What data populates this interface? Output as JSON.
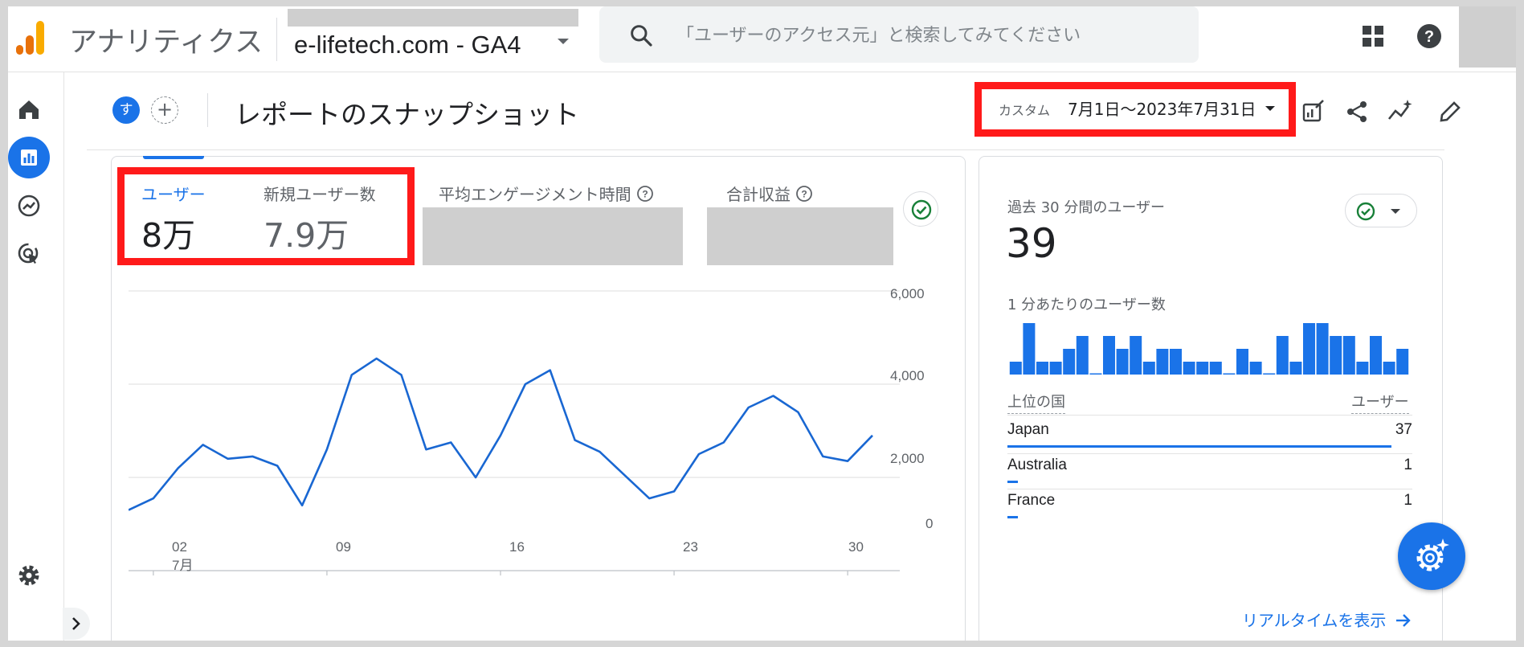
{
  "app": {
    "title": "アナリティクス",
    "property": "e-lifetech.com - GA4"
  },
  "search": {
    "placeholder": "「ユーザーのアクセス元」と検索してみてください"
  },
  "header": {
    "avatar_letter": "す",
    "add_label": "+",
    "page_title": "レポートのスナップショット",
    "date_label": "カスタム",
    "date_value": "7月1日〜2023年7月31日"
  },
  "metrics": [
    {
      "label": "ユーザー",
      "value": "8万"
    },
    {
      "label": "新規ユーザー数",
      "value": "7.9万"
    },
    {
      "label": "平均エンゲージメント時間",
      "value": ""
    },
    {
      "label": "合計収益",
      "value": ""
    }
  ],
  "chart_data": {
    "type": "line",
    "x": [
      "7/1",
      "7/2",
      "7/3",
      "7/4",
      "7/5",
      "7/6",
      "7/7",
      "7/8",
      "7/9",
      "7/10",
      "7/11",
      "7/12",
      "7/13",
      "7/14",
      "7/15",
      "7/16",
      "7/17",
      "7/18",
      "7/19",
      "7/20",
      "7/21",
      "7/22",
      "7/23",
      "7/24",
      "7/25",
      "7/26",
      "7/27",
      "7/28",
      "7/29",
      "7/30",
      "7/31"
    ],
    "series": [
      {
        "values": [
          1300,
          1550,
          2200,
          2700,
          2400,
          2450,
          2250,
          1400,
          2600,
          4200,
          4550,
          4200,
          2600,
          2750,
          2000,
          2900,
          4000,
          4300,
          2800,
          2550,
          2050,
          1550,
          1700,
          2500,
          2750,
          3500,
          3750,
          3400,
          2450,
          2350,
          2900
        ]
      }
    ],
    "xtick_labels": [
      "02",
      "09",
      "16",
      "23",
      "30"
    ],
    "xtick_sublabel": "7月",
    "ytick_labels": [
      "6,000",
      "4,000",
      "2,000",
      "0"
    ],
    "ylim": [
      0,
      6000
    ],
    "grid": true,
    "color": "#1967d2"
  },
  "realtime": {
    "label": "過去 30 分間のユーザー",
    "value": "39",
    "per_minute_label": "1 分あたりのユーザー数",
    "per_minute_bars": [
      1,
      4,
      1,
      1,
      2,
      3,
      0,
      3,
      2,
      3,
      1,
      2,
      2,
      1,
      1,
      1,
      0,
      2,
      1,
      0,
      3,
      1,
      4,
      4,
      3,
      3,
      1,
      3,
      1,
      2
    ],
    "col_country": "上位の国",
    "col_users": "ユーザー",
    "countries": [
      {
        "name": "Japan",
        "users": "37",
        "share": 1.0
      },
      {
        "name": "Australia",
        "users": "1",
        "share": 0.027
      },
      {
        "name": "France",
        "users": "1",
        "share": 0.027
      }
    ],
    "link": "リアルタイムを表示"
  },
  "colors": {
    "accent": "#1a73e8",
    "highlight": "#ff1a1a",
    "redaction": "#cfcfcf"
  }
}
